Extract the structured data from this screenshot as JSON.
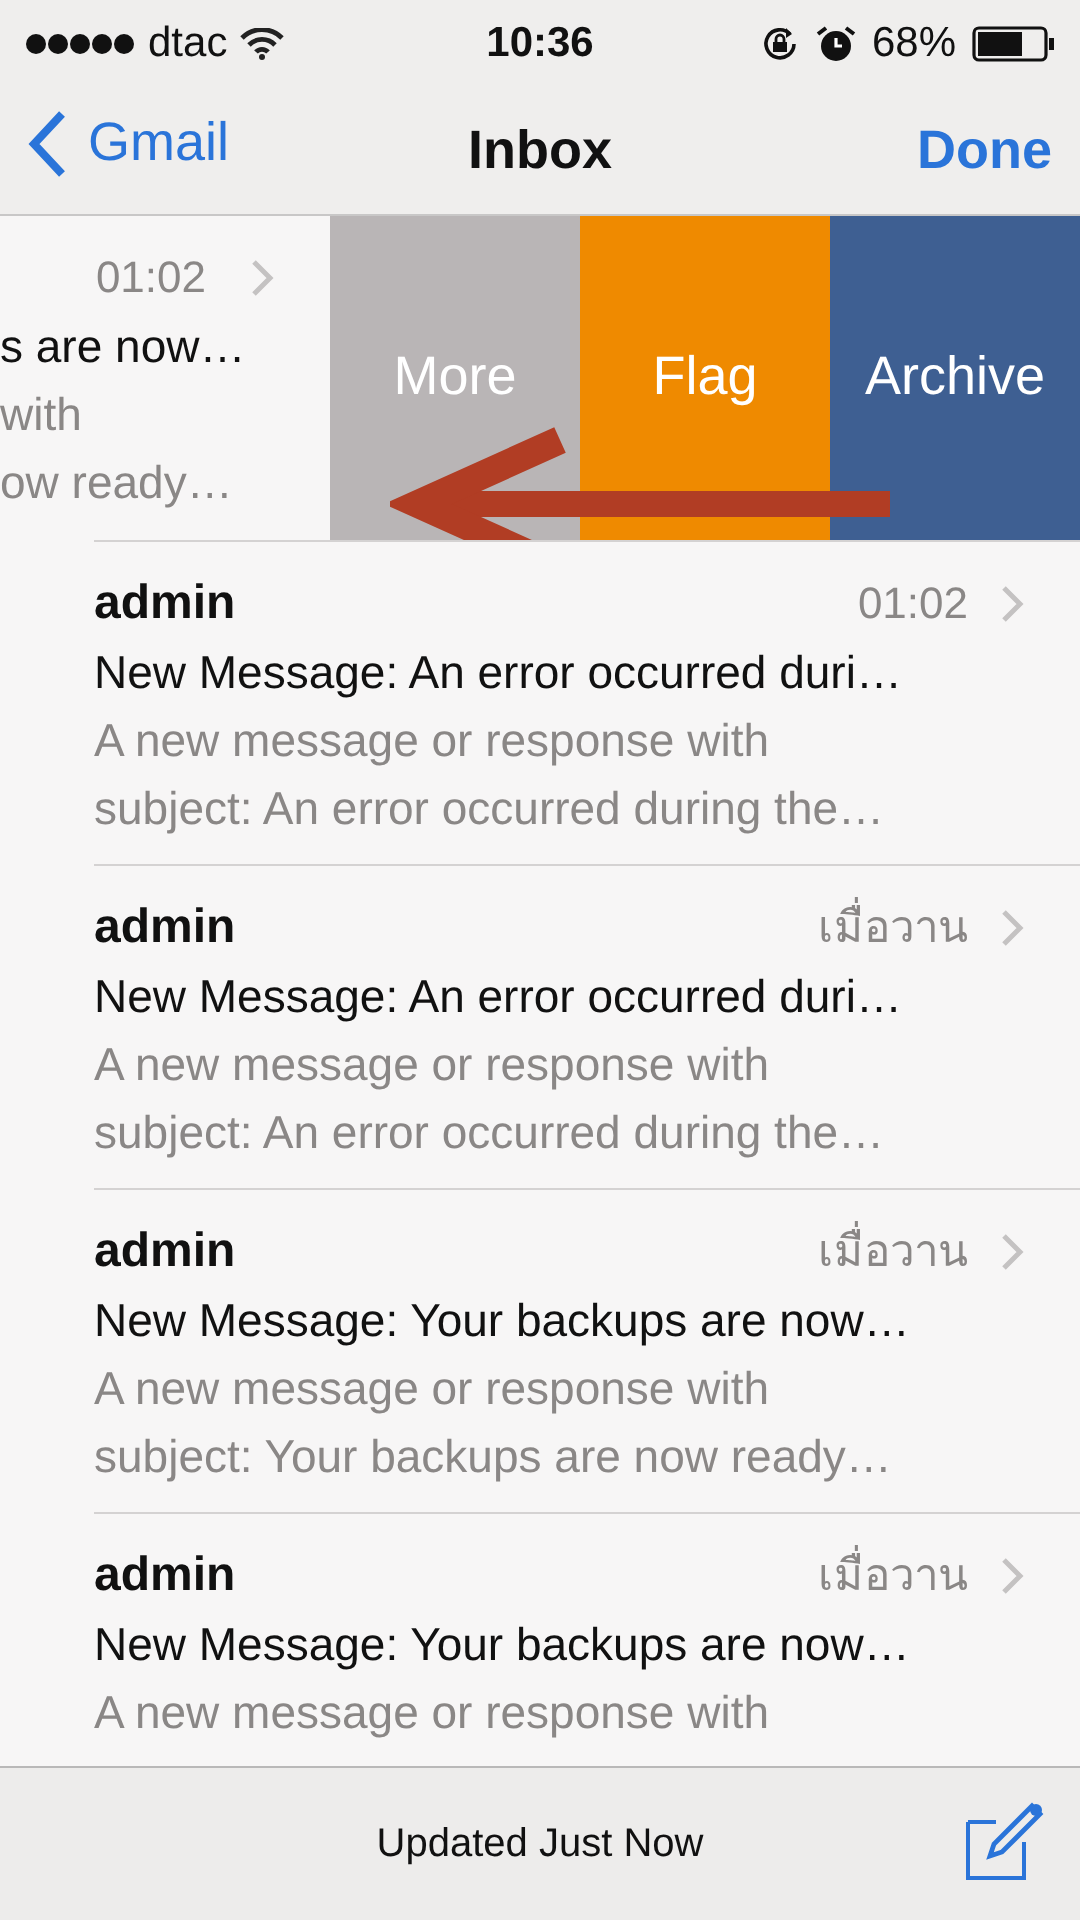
{
  "status_bar": {
    "carrier": "dtac",
    "time": "10:36",
    "battery": "68%"
  },
  "nav": {
    "back": "Gmail",
    "title": "Inbox",
    "action": "Done"
  },
  "swiped_row": {
    "time": "01:02",
    "subject": "s are now…",
    "preview": [
      "with",
      "ow ready…"
    ],
    "actions": [
      {
        "label": "More",
        "color": "#b9b5b6"
      },
      {
        "label": "Flag",
        "color": "#ef8a00"
      },
      {
        "label": "Archive",
        "color": "#3e5f92"
      }
    ]
  },
  "messages": [
    {
      "from": "admin",
      "time": "01:02",
      "subject": "New Message: An error occurred duri…",
      "preview": [
        "A new message or response with",
        "subject: An error occurred during the…"
      ]
    },
    {
      "from": "admin",
      "time": "เมื่อวาน",
      "subject": "New Message: An error occurred duri…",
      "preview": [
        "A new message or response with",
        "subject: An error occurred during the…"
      ]
    },
    {
      "from": "admin",
      "time": "เมื่อวาน",
      "subject": "New Message: Your backups are now…",
      "preview": [
        "A new message or response with",
        "subject: Your backups are now ready…"
      ]
    },
    {
      "from": "admin",
      "time": "เมื่อวาน",
      "subject": "New Message: Your backups are now…",
      "preview": [
        "A new message or response with"
      ]
    }
  ],
  "toolbar": {
    "status": "Updated Just Now"
  }
}
